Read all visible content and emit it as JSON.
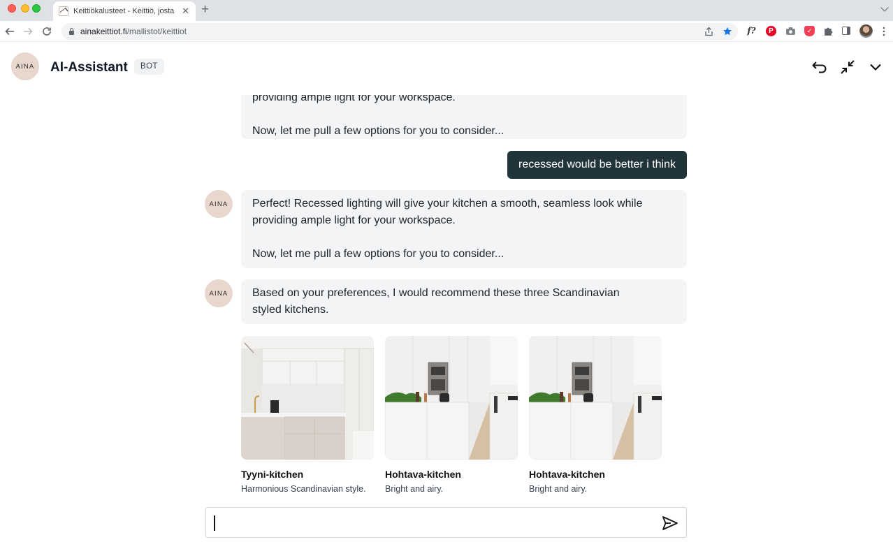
{
  "browser": {
    "tab_title": "Keittiökalusteet - Keittiö, josta",
    "tab_close": "✕",
    "new_tab": "+",
    "url_host": "ainakeittiot.fi",
    "url_path": "/mallistot/keittiot",
    "extension_f_label": "f?",
    "extension_pinterest_label": "P",
    "extension_pocket_label": "✓"
  },
  "header": {
    "logo_text": "AINA",
    "title": "AI-Assistant",
    "badge": "BOT"
  },
  "messages": {
    "bot_partial": {
      "line1": "providing ample light for your workspace.",
      "line2": "Now, let me pull a few options for you to consider..."
    },
    "user_1": "recessed would be better i think",
    "bot_1": {
      "line1": "Perfect! Recessed lighting will give your kitchen a smooth, seamless look while providing ample light for your workspace.",
      "line2": "Now, let me pull a few options for you to consider..."
    },
    "bot_2": "Based on your preferences, I would recommend these three Scandinavian styled kitchens.",
    "avatar_text": "AINA"
  },
  "recommendations": [
    {
      "title": "Tyyni-kitchen",
      "subtitle": "Harmonious Scandinavian style."
    },
    {
      "title": "Hohtava-kitchen",
      "subtitle": "Bright and airy."
    },
    {
      "title": "Hohtava-kitchen",
      "subtitle": "Bright and airy."
    }
  ],
  "composer": {
    "value": "",
    "placeholder": ""
  }
}
